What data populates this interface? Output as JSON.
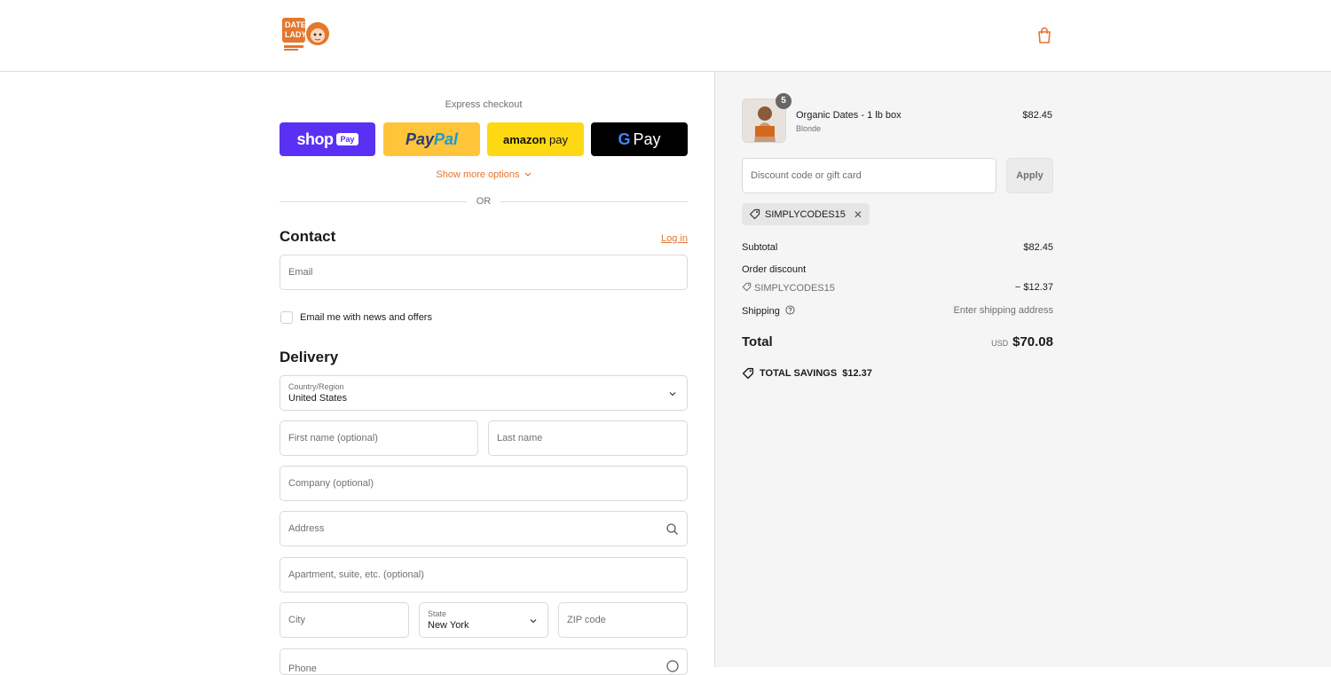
{
  "brand": {
    "logo_text_line1": "DATE",
    "logo_text_line2": "LADY",
    "accent": "#e4772e"
  },
  "express": {
    "title": "Express checkout",
    "shop_label": "shop",
    "shop_chip": "Pay",
    "paypal_part1": "Pay",
    "paypal_part2": "Pal",
    "amazon_part1": "amazon",
    "amazon_part2": " pay",
    "gpay_g": "G",
    "gpay_label": "Pay",
    "more_options": "Show more options",
    "or_text": "OR"
  },
  "contact": {
    "title": "Contact",
    "login": "Log in",
    "email_placeholder": "Email",
    "newsletter_label": "Email me with news and offers"
  },
  "delivery": {
    "title": "Delivery",
    "country_label": "Country/Region",
    "country_value": "United States",
    "first_name": "First name (optional)",
    "last_name": "Last name",
    "company": "Company (optional)",
    "address": "Address",
    "apartment": "Apartment, suite, etc. (optional)",
    "city": "City",
    "state_label": "State",
    "state_value": "New York",
    "zip": "ZIP code",
    "phone": "Phone"
  },
  "order": {
    "quantity": "5",
    "product_name": "Organic Dates - 1 lb box",
    "variant": "Blonde",
    "price": "$82.45",
    "discount_placeholder": "Discount code or gift card",
    "apply": "Apply",
    "applied_code": "SIMPLYCODES15",
    "subtotal_label": "Subtotal",
    "subtotal_value": "$82.45",
    "order_discount_label": "Order discount",
    "discount_code": "SIMPLYCODES15",
    "discount_value": "− $12.37",
    "shipping_label": "Shipping",
    "shipping_value": "Enter shipping address",
    "total_label": "Total",
    "currency": "USD",
    "total_value": "$70.08",
    "savings_label": "TOTAL SAVINGS",
    "savings_value": "$12.37"
  }
}
